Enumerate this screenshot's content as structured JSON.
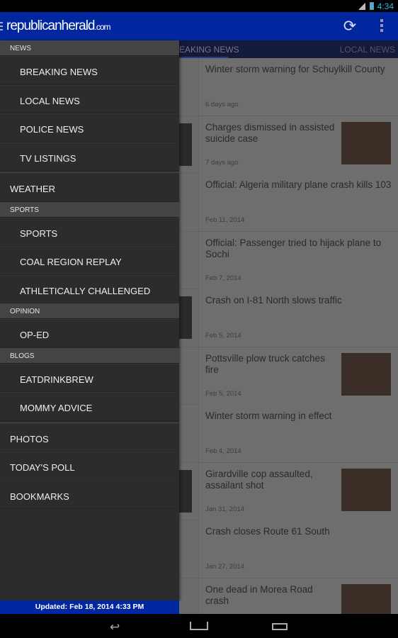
{
  "status": {
    "time": "4:34",
    "icons": [
      "signal-icon",
      "battery-icon"
    ]
  },
  "actionbar": {
    "logo_main": "republicanherald",
    "logo_suffix": ".com",
    "refresh_icon": "refresh-icon",
    "overflow_icon": "overflow-menu-icon"
  },
  "tabs": [
    {
      "label": "BREAKING NEWS",
      "visible": "EAKING NEWS"
    },
    {
      "label": "LOCAL NEWS"
    }
  ],
  "articles": [
    {
      "title": "Winter storm warning for Schuylkill County",
      "date": "6 days ago",
      "thumb": false
    },
    {
      "title": "Charges dismissed in assisted suicide case",
      "date": "7 days ago",
      "thumb": true
    },
    {
      "title": "Official: Algeria military plane crash kills 103",
      "date": "Feb 11, 2014",
      "thumb": false
    },
    {
      "title": "Official: Passenger tried to hijack plane to Sochi",
      "date": "Feb 7, 2014",
      "thumb": false
    },
    {
      "title": "Crash on I-81 North slows traffic",
      "date": "Feb 5, 2014",
      "thumb": false
    },
    {
      "title": "Pottsville plow truck catches fire",
      "date": "Feb 5, 2014",
      "thumb": true
    },
    {
      "title": "Winter storm warning in effect",
      "date": "Feb 4, 2014",
      "thumb": false
    },
    {
      "title": "Girardville cop assaulted, assailant shot",
      "date": "Jan 31, 2014",
      "thumb": true
    },
    {
      "title": "Crash closes Route 61 South",
      "date": "Jan 27, 2014",
      "thumb": false
    },
    {
      "title": "One dead in Morea Road crash",
      "date": "",
      "thumb": true
    }
  ],
  "drawer": {
    "news_header": "NEWS",
    "breaking": "BREAKING NEWS",
    "local": "LOCAL NEWS",
    "police": "POLICE NEWS",
    "tv": "TV LISTINGS",
    "weather": "WEATHER",
    "sports_header": "SPORTS",
    "sports": "SPORTS",
    "coal": "COAL REGION REPLAY",
    "athletic": "ATHLETICALLY CHALLENGED",
    "opinion_header": "OPINION",
    "oped": "OP-ED",
    "blogs_header": "BLOGS",
    "eat": "EATDRINKBREW",
    "mommy": "MOMMY ADVICE",
    "photos": "PHOTOS",
    "poll": "TODAY'S POLL",
    "bookmarks": "BOOKMARKS"
  },
  "updated": "Updated: Feb 18, 2014 4:33 PM",
  "navbar": {
    "back": "back-icon",
    "home": "home-icon",
    "recents": "recents-icon"
  },
  "colors": {
    "brand": "#0026a0",
    "drawer": "#2c2c2c",
    "accent": "#33b5e5"
  }
}
